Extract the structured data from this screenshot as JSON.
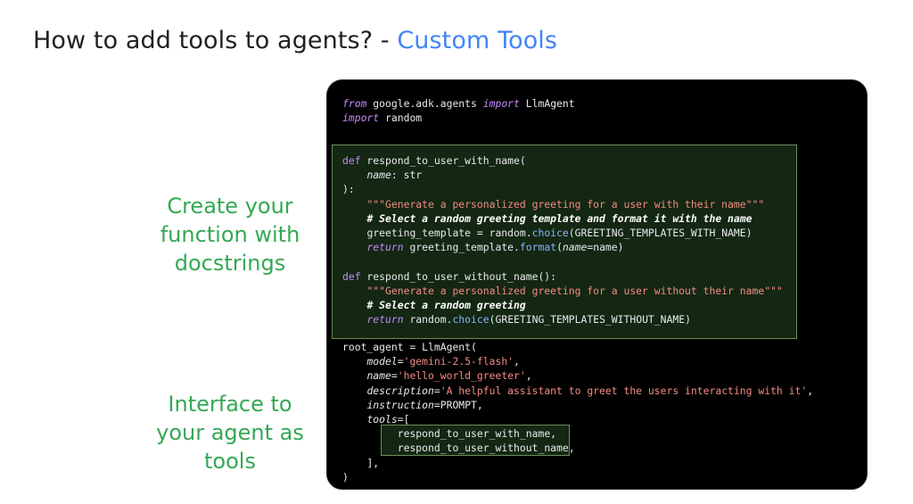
{
  "slide": {
    "title_main": "How to add tools to agents? - ",
    "title_accent": "Custom Tools",
    "caption_function": [
      "Create your",
      "function with",
      "docstrings"
    ],
    "caption_interface": [
      "Interface to",
      "your agent as",
      "tools"
    ]
  },
  "colors": {
    "accent_blue": "#4285f4",
    "caption_green": "#34a853",
    "code_background": "#000000",
    "highlight_border": "#6c8f5a"
  },
  "code": {
    "imports": {
      "line1": {
        "kw_from": "from",
        "module": " google.adk.agents ",
        "kw_import": "import",
        "name": " LlmAgent"
      },
      "line2": {
        "kw_import": "import",
        "name": " random"
      }
    },
    "fn1": {
      "def": "def",
      "name": " respond_to_user_with_name(",
      "param": "name",
      "param_type": ": str",
      "close": "):",
      "docstring": "\"\"\"Generate a personalized greeting for a user with their name\"\"\"",
      "comment": "# Select a random greeting template and format it with the name",
      "assign_a": "greeting_template = random.",
      "choice": "choice",
      "assign_b": "(GREETING_TEMPLATES_WITH_NAME)",
      "return_kw": "return",
      "return_a": " greeting_template.",
      "format": "format",
      "return_b": "(",
      "return_arg": "name",
      "return_c": "=name)"
    },
    "fn2": {
      "def": "def",
      "name": " respond_to_user_without_name():",
      "docstring": "\"\"\"Generate a personalized greeting for a user without their name\"\"\"",
      "comment": "# Select a random greeting",
      "return_kw": "return",
      "return_a": " random.",
      "choice": "choice",
      "return_b": "(GREETING_TEMPLATES_WITHOUT_NAME)"
    },
    "agent": {
      "head": "root_agent = LlmAgent(",
      "model_key": "model",
      "model_val": "'gemini-2.5-flash'",
      "name_key": "name",
      "name_val": "'hello_world_greeter'",
      "desc_key": "description",
      "desc_val": "'A helpful assistant to greet the users interacting with it'",
      "instr_key": "instruction",
      "instr_val": "=PROMPT,",
      "tools_key": "tools",
      "tools_open": "=[",
      "tool1": "respond_to_user_with_name,",
      "tool2": "respond_to_user_without_name,",
      "tools_close": "],",
      "end": ")"
    }
  }
}
